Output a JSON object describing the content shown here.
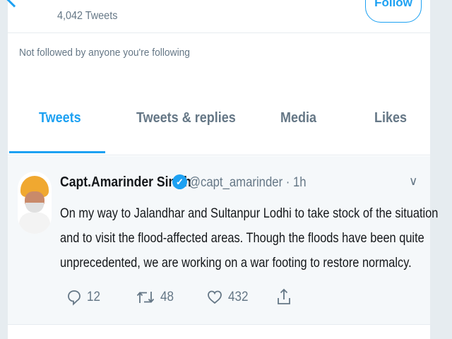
{
  "profile": {
    "tweet_count": "4,042 Tweets",
    "follow_label": "Follow",
    "not_followed_text": "Not followed by anyone you're following"
  },
  "tabs": [
    {
      "label": "Tweets",
      "active": true
    },
    {
      "label": "Tweets & replies",
      "active": false
    },
    {
      "label": "Media",
      "active": false
    },
    {
      "label": "Likes",
      "active": false
    }
  ],
  "tweet": {
    "name": "Capt.Amarinder Singh",
    "handle_time": "@capt_amarinder · 1h",
    "lines": [
      "On my way to Jalandhar and Sultanpur Lodhi to take stock of the situation",
      "and to visit the flood-affected areas. Though the floods have been quite",
      "unprecedented, we are working on a war footing to restore normalcy."
    ],
    "replies": "12",
    "retweets": "48",
    "likes": "432"
  },
  "colors": {
    "accent": "#1da1f2",
    "muted": "#657786"
  },
  "icons": [
    "back-arrow-icon",
    "verified-icon",
    "chevron-down-icon",
    "reply-icon",
    "retweet-icon",
    "like-icon",
    "share-icon"
  ]
}
